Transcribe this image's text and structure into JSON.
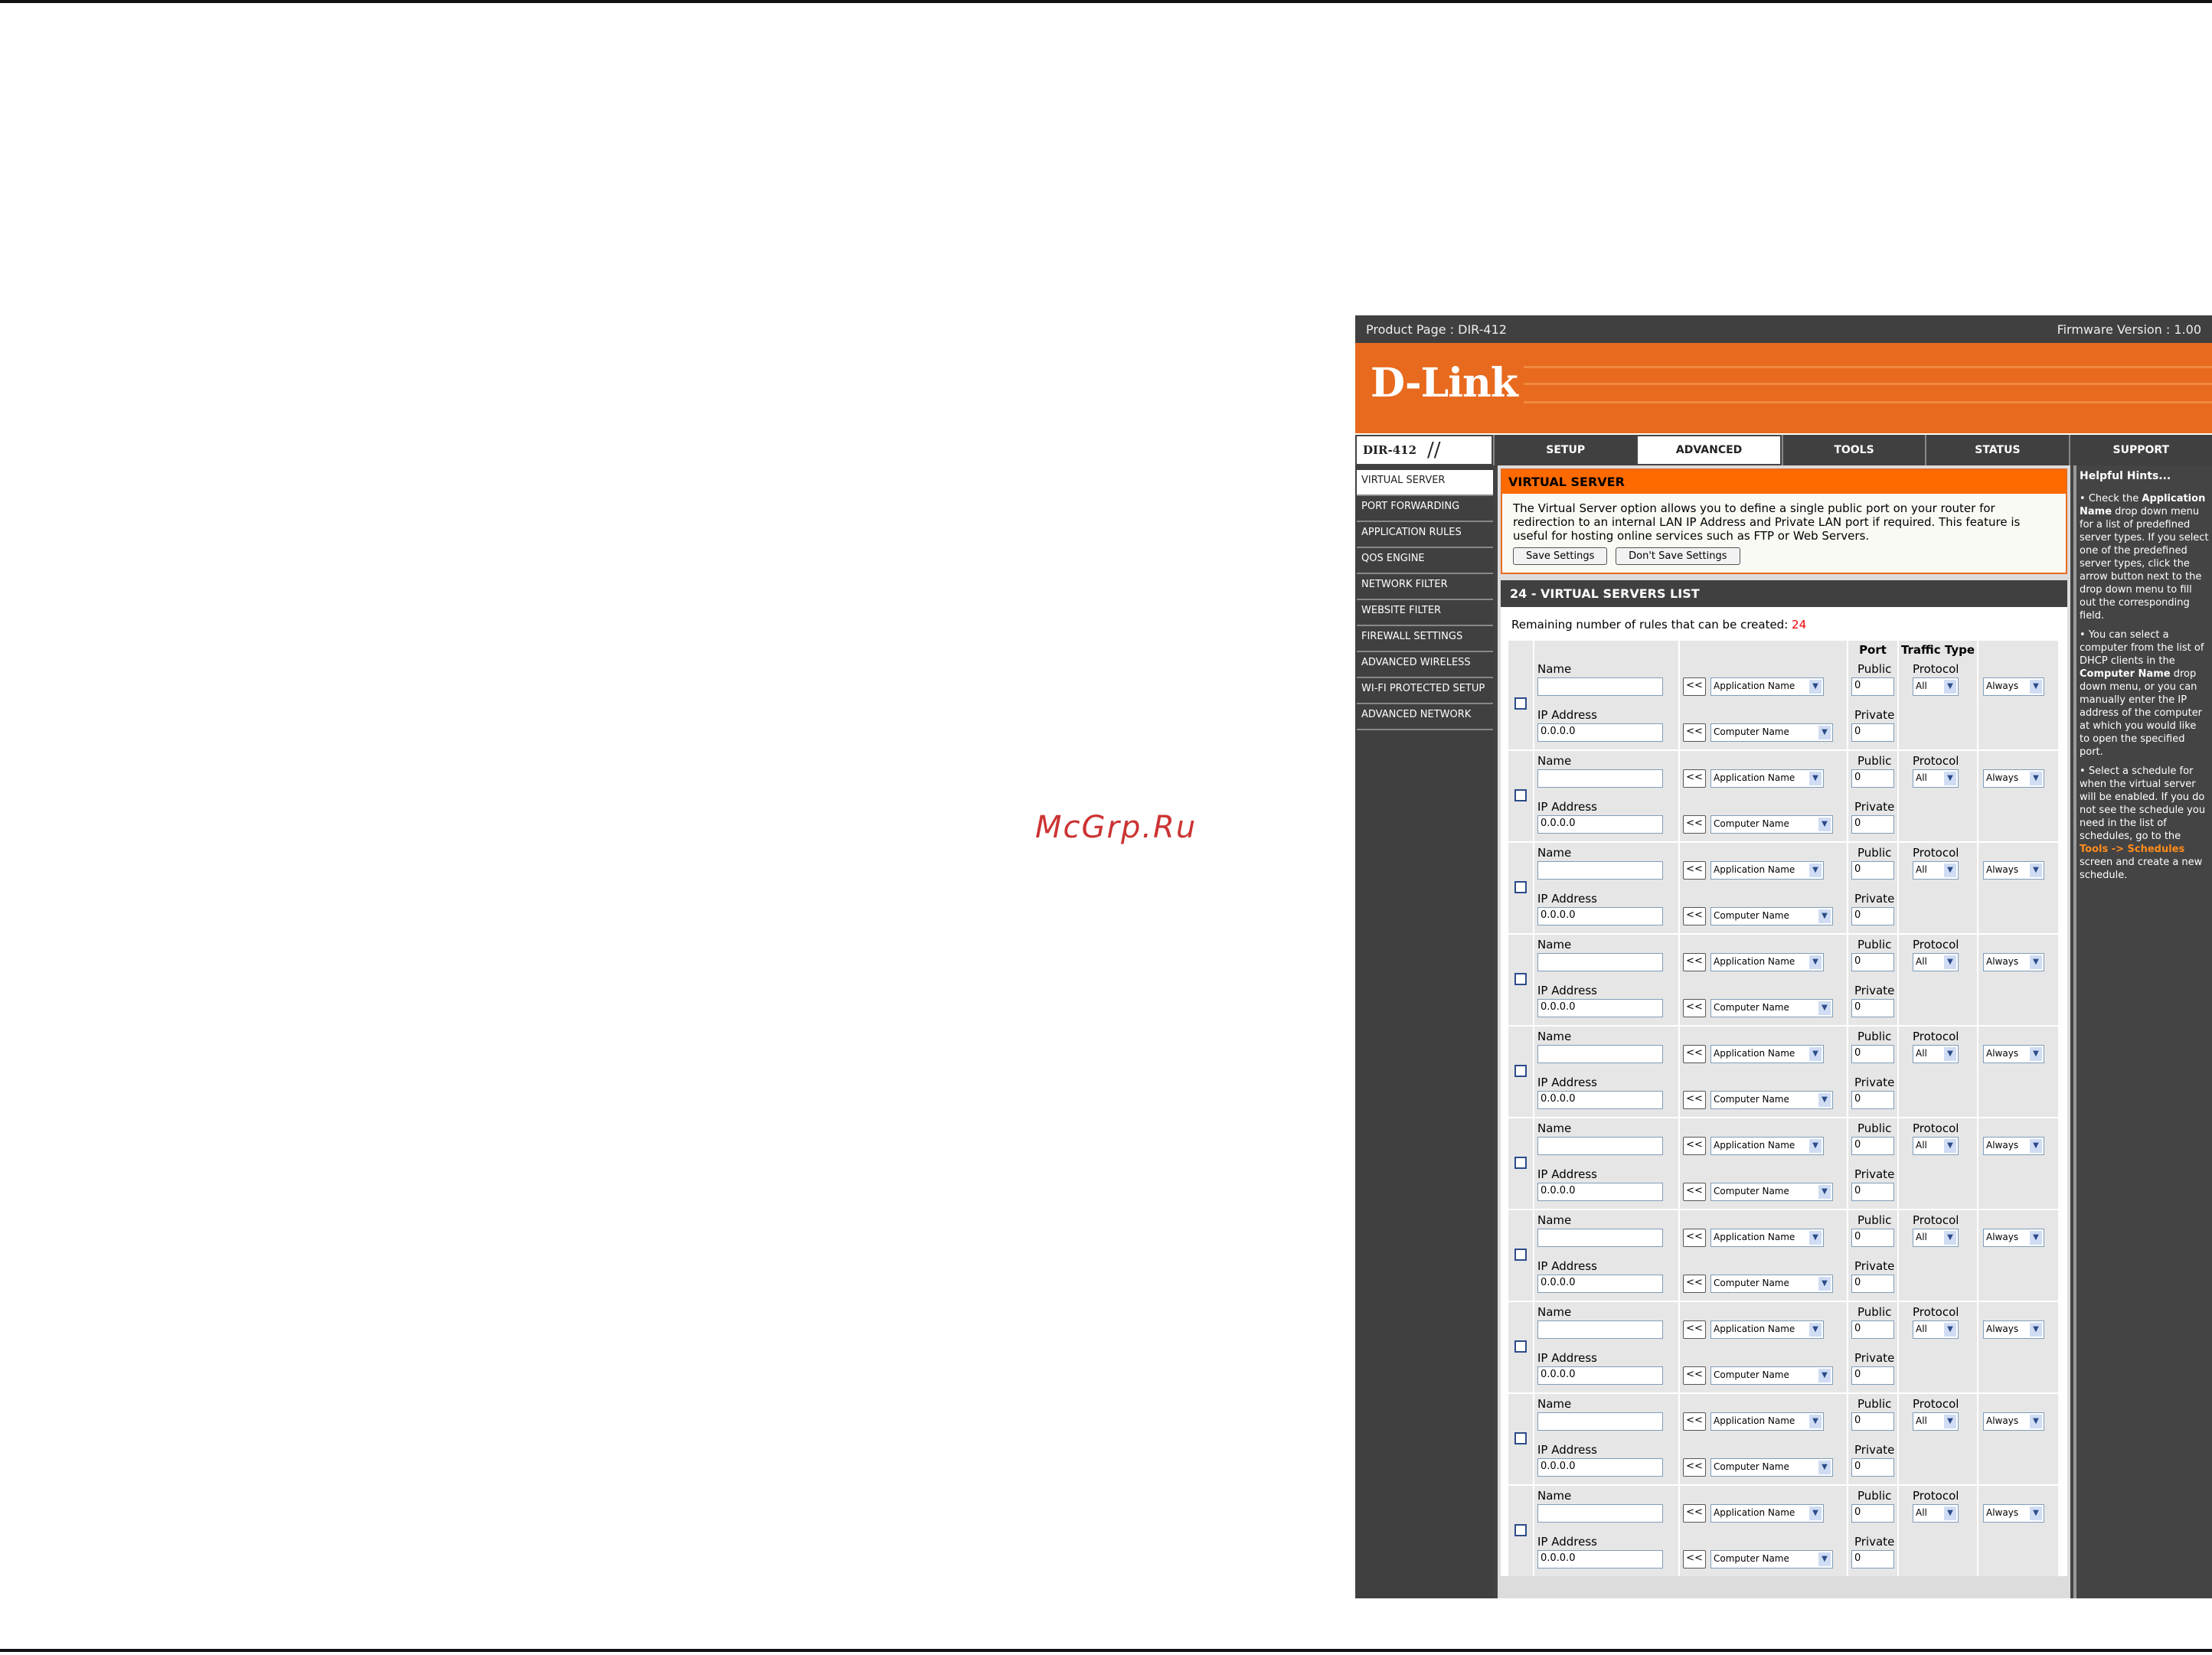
{
  "watermark": "McGrp.Ru",
  "topbar": {
    "product": "Product Page : DIR-412",
    "firmware": "Firmware Version : 1.00"
  },
  "brand": {
    "logo": "D-Link",
    "model": "DIR-412",
    "slashes": "//"
  },
  "tabs": [
    "SETUP",
    "ADVANCED",
    "TOOLS",
    "STATUS",
    "SUPPORT"
  ],
  "active_tab": "ADVANCED",
  "sidebar": [
    "VIRTUAL SERVER",
    "PORT FORWARDING",
    "APPLICATION RULES",
    "QOS ENGINE",
    "NETWORK FILTER",
    "WEBSITE FILTER",
    "FIREWALL SETTINGS",
    "ADVANCED WIRELESS",
    "WI-FI PROTECTED SETUP",
    "ADVANCED NETWORK"
  ],
  "virtual_server": {
    "title": "VIRTUAL SERVER",
    "description": "The Virtual Server option allows you to define a single public port on your router for redirection to an internal LAN IP Address and Private LAN port if required. This feature is useful for hosting online services such as FTP or Web Servers.",
    "save": "Save Settings",
    "dont_save": "Don't Save Settings"
  },
  "list": {
    "title": "24 - VIRTUAL SERVERS LIST",
    "remaining_label": "Remaining number of rules that can be created: ",
    "remaining_count": "24",
    "header_port": "Port",
    "header_traffic": "Traffic Type"
  },
  "row": {
    "name_label": "Name",
    "ip_label": "IP Address",
    "ip_value": "0.0.0.0",
    "arrow": "<<",
    "app_select": "Application Name",
    "computer_select": "Computer Name",
    "public_label": "Public",
    "private_label": "Private",
    "port_value": "0",
    "protocol_label": "Protocol",
    "protocol_value": "All",
    "schedule_value": "Always"
  },
  "row_count": 10,
  "hints": {
    "title": "Helpful Hints...",
    "h1a": "Check the ",
    "h1b": "Application Name",
    "h1c": " drop down menu for a list of predefined server types. If you select one of the predefined server types, click the arrow button next to the drop down menu to fill out the corresponding field.",
    "h2a": "You can select a computer from the list of DHCP clients in the ",
    "h2b": "Computer Name",
    "h2c": " drop down menu, or you can manually enter the IP address of the computer at which you would like to open the specified port.",
    "h3a": "Select a schedule for when the virtual server will be enabled. If you do not see the schedule you need in the list of schedules, go to the ",
    "h3b": "Tools -> Schedules",
    "h3c": " screen and create a new schedule."
  }
}
